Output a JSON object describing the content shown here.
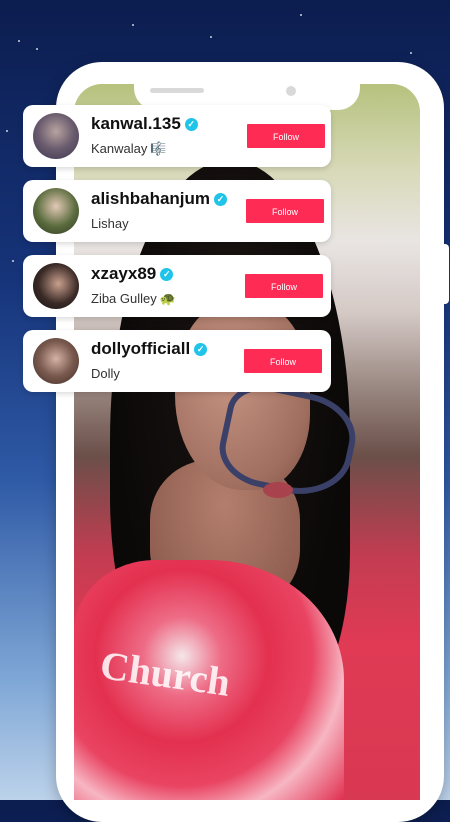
{
  "suggested_accounts": [
    {
      "username": "kanwal.135",
      "display_name": "Kanwalay",
      "badge_emoji": "🎼",
      "follow_label": "Follow"
    },
    {
      "username": "alishbahanjum",
      "display_name": "Lishay",
      "badge_emoji": "",
      "follow_label": "Follow"
    },
    {
      "username": "xzayx89",
      "display_name": "Ziba Gulley",
      "badge_emoji": "🐢",
      "follow_label": "Follow"
    },
    {
      "username": "dollyofficiall",
      "display_name": "Dolly",
      "badge_emoji": "",
      "follow_label": "Follow"
    }
  ],
  "colors": {
    "follow_button": "#fe2c55",
    "verified_badge": "#20c4e8",
    "background_top": "#0c1d4f",
    "background_bottom": "#bcd2ea"
  },
  "shirt_text": "Church"
}
